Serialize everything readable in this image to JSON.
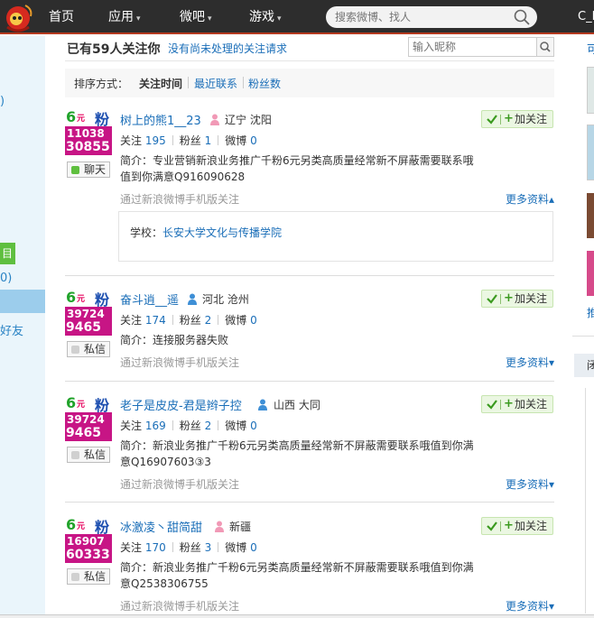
{
  "topbar": {
    "nav": [
      {
        "label": "首页",
        "has_caret": false
      },
      {
        "label": "应用",
        "has_caret": true
      },
      {
        "label": "微吧",
        "has_caret": true
      },
      {
        "label": "游戏",
        "has_caret": true
      }
    ],
    "caret": "▾",
    "search_placeholder": "搜索微博、找人",
    "user_abbr": "C_L"
  },
  "left_fragments": [
    ")",
    "目",
    "0)",
    "好友"
  ],
  "header": {
    "count_title": "已有59人关注你",
    "pending_link": "没有尚未处理的关注请求",
    "nick_placeholder": "输入昵称"
  },
  "sort": {
    "label": "排序方式：",
    "options": [
      "关注时间",
      "最近联系",
      "粉丝数"
    ],
    "active": "关注时间"
  },
  "labels": {
    "follows": "关注",
    "fans": "粉丝",
    "weibo": "微博",
    "follow_button": "加关注",
    "via": "通过新浪微博手机版关注",
    "more_info": "更多资料",
    "school_key": "学校："
  },
  "badge_text": {
    "six": "6",
    "yuan": "元",
    "fen": "粉"
  },
  "users": [
    {
      "name": "树上的熊1__23",
      "gender": "female",
      "location": "辽宁 沈阳",
      "follows": "195",
      "fans": "1",
      "weibo": "0",
      "intro": "简介：专业营销新浪业务推广千粉6元另类高质量经常新不屏蔽需要联系哦值到你满意Q916090628",
      "badge_n1": "11038",
      "badge_n2": "30855",
      "action": "聊天",
      "action_color": "#5fbf3f",
      "more_arrow": "▴",
      "school": "长安大学文化与传播学院"
    },
    {
      "name": "奋斗逍__遥",
      "gender": "male",
      "location": "河北 沧州",
      "follows": "174",
      "fans": "2",
      "weibo": "0",
      "intro": "简介：连接服务器失败",
      "badge_n1": "39724",
      "badge_n2": "9465",
      "action": "私信",
      "action_color": "#d0d0d0",
      "more_arrow": "▾"
    },
    {
      "name": "老子是皮皮-君是辫子控",
      "gender": "male",
      "location": "山西 大同",
      "follows": "169",
      "fans": "2",
      "weibo": "0",
      "intro": "简介：新浪业务推广千粉6元另类高质量经常新不屏蔽需要联系哦值到你满意Q16907603③3",
      "badge_n1": "39724",
      "badge_n2": "9465",
      "action": "私信",
      "action_color": "#d0d0d0",
      "more_arrow": "▾"
    },
    {
      "name": "冰激凌丶甜简甜",
      "gender": "female",
      "location": "新疆",
      "follows": "170",
      "fans": "3",
      "weibo": "0",
      "intro": "简介：新浪业务推广千粉6元另类高质量经常新不屏蔽需要联系哦值到你满意Q2538306755",
      "badge_n1": "16907",
      "badge_n2": "60333",
      "action": "私信",
      "action_color": "#d0d0d0",
      "more_arrow": "▾"
    }
  ],
  "right_fragments": [
    "可",
    "推",
    "闭"
  ],
  "colors": {
    "link": "#1a6eb8",
    "topbar": "#2d2d2d",
    "badge_pink": "#c71585",
    "follow_green": "#3b9a1f"
  }
}
